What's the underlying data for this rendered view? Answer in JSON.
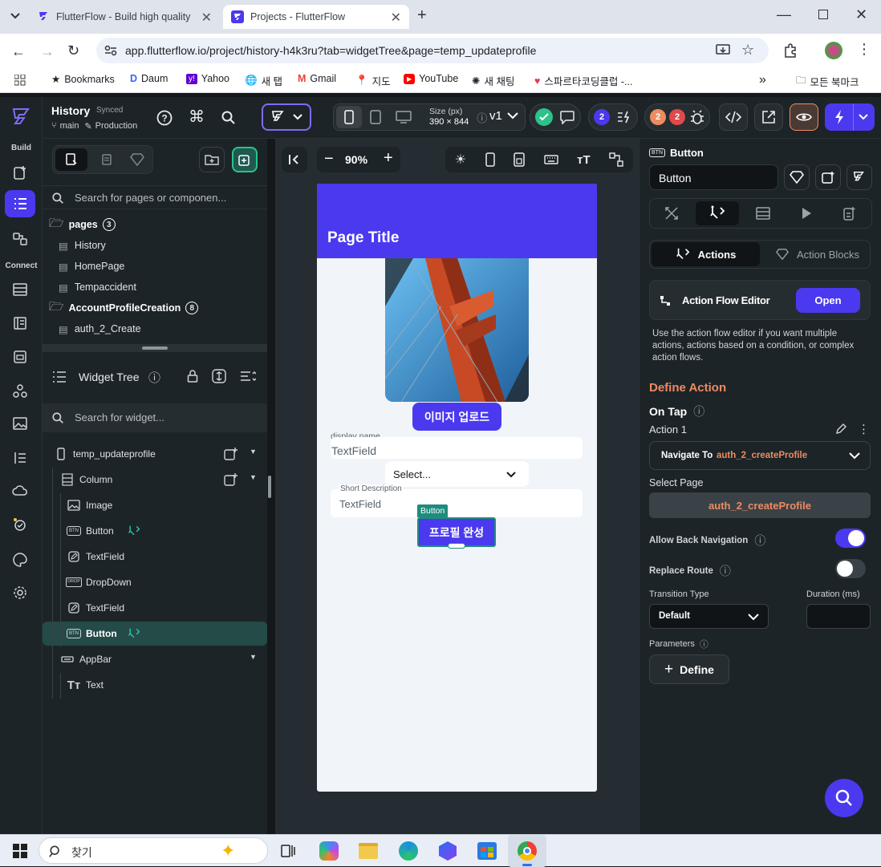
{
  "browser": {
    "tabs": [
      {
        "title": "FlutterFlow - Build high quality",
        "active": false
      },
      {
        "title": "Projects - FlutterFlow",
        "active": true
      }
    ],
    "url": "app.flutterflow.io/project/history-h4k3ru?tab=widgetTree&page=temp_updateprofile",
    "bookmarks": [
      "Bookmarks",
      "Daum",
      "Yahoo",
      "새 탭",
      "Gmail",
      "지도",
      "YouTube",
      "새 채팅",
      "스파르타코딩클럽 -..."
    ],
    "all_bookmarks": "모든 북마크"
  },
  "rail": {
    "build_label": "Build",
    "connect_label": "Connect"
  },
  "header": {
    "project_name": "History",
    "sync_status": "Synced",
    "branch": "main",
    "environment": "Production",
    "size_label": "Size (px)",
    "size_value": "390 × 844",
    "version": "v1",
    "badge_count_1": "2",
    "badge_count_2": "2",
    "badge_count_3": "2"
  },
  "left_panel": {
    "search_pages_placeholder": "Search for pages or componen...",
    "folders": [
      {
        "name": "pages",
        "count": "3",
        "items": [
          "History",
          "HomePage",
          "Tempaccident"
        ]
      },
      {
        "name": "AccountProfileCreation",
        "count": "8",
        "items": [
          "auth_2_Create"
        ]
      }
    ],
    "widget_tree_title": "Widget Tree",
    "search_widget_placeholder": "Search for widget...",
    "tree": [
      {
        "label": "temp_updateprofile",
        "indent": 0,
        "icon": "phone-icon",
        "selected": false,
        "action": false
      },
      {
        "label": "Column",
        "indent": 1,
        "icon": "column-icon",
        "selected": false,
        "action": false
      },
      {
        "label": "Image",
        "indent": 2,
        "icon": "image-icon",
        "selected": false,
        "action": false
      },
      {
        "label": "Button",
        "indent": 2,
        "icon": "button-icon",
        "selected": false,
        "action": true
      },
      {
        "label": "TextField",
        "indent": 2,
        "icon": "textfield-icon",
        "selected": false,
        "action": false
      },
      {
        "label": "DropDown",
        "indent": 2,
        "icon": "dropdown-icon",
        "selected": false,
        "action": false
      },
      {
        "label": "TextField",
        "indent": 2,
        "icon": "textfield-icon",
        "selected": false,
        "action": false
      },
      {
        "label": "Button",
        "indent": 2,
        "icon": "button-icon",
        "selected": true,
        "action": true
      },
      {
        "label": "AppBar",
        "indent": 1,
        "icon": "appbar-icon",
        "selected": false,
        "action": false
      },
      {
        "label": "Text",
        "indent": 2,
        "icon": "text-icon",
        "selected": false,
        "action": false
      }
    ]
  },
  "canvas": {
    "zoom": "90%",
    "page_title": "Page Title",
    "upload_button": "이미지 업로드",
    "display_name_label": "display name",
    "textfield_1": "TextField",
    "dropdown_placeholder": "Select...",
    "short_desc_label": "Short Description",
    "textfield_2": "TextField",
    "selected_tag": "Button",
    "complete_button": "프로필 완성"
  },
  "right_panel": {
    "widget_type": "Button",
    "widget_name": "Button",
    "tab_actions": "Actions",
    "tab_action_blocks": "Action Blocks",
    "editor_title": "Action Flow Editor",
    "editor_open": "Open",
    "editor_desc": "Use the action flow editor if you want multiple actions, actions based on a condition, or complex action flows.",
    "define_action": "Define Action",
    "on_tap": "On Tap",
    "action_1": "Action 1",
    "navigate_to": "Navigate To",
    "navigate_target": "auth_2_createProfile",
    "select_page_label": "Select Page",
    "select_page_value": "auth_2_createProfile",
    "allow_back_nav": "Allow Back Navigation",
    "allow_back_nav_on": true,
    "replace_route": "Replace Route",
    "replace_route_on": false,
    "transition_type_label": "Transition Type",
    "transition_type_value": "Default",
    "duration_label": "Duration (ms)",
    "parameters_label": "Parameters",
    "define_button": "Define"
  },
  "taskbar": {
    "search_label": "찾기"
  },
  "colors": {
    "accent": "#4b39ef",
    "teal": "#1f8c7d",
    "orange": "#ee8b60",
    "panel": "#1d2428"
  }
}
